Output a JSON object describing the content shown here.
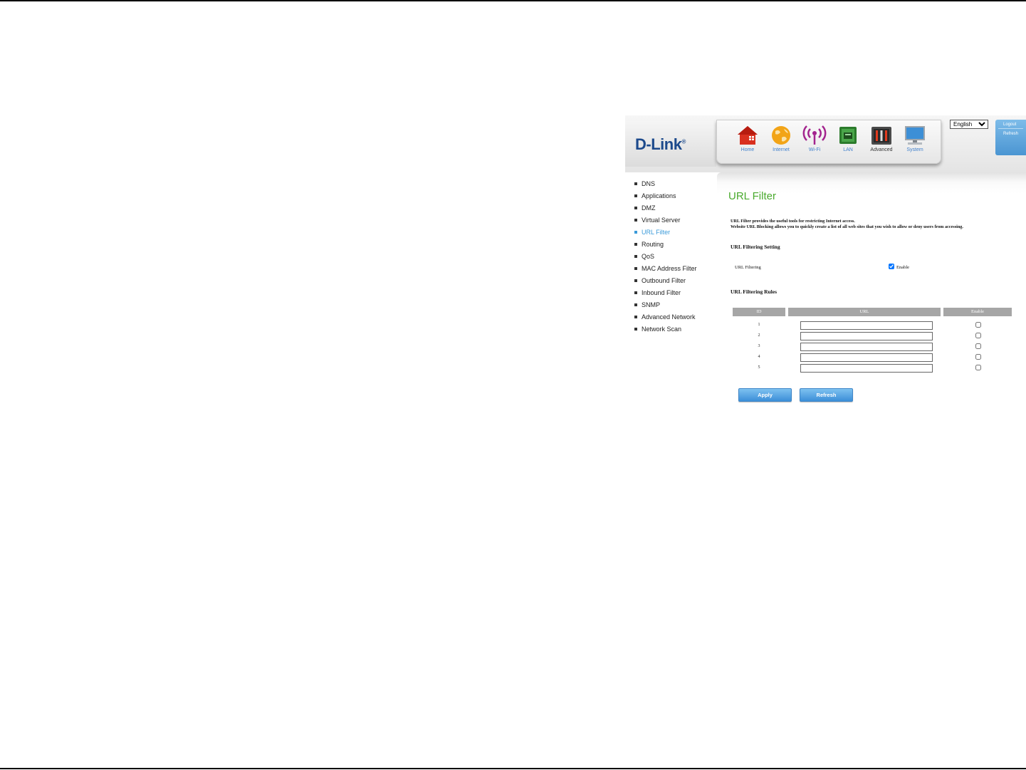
{
  "brand": {
    "logo_text": "D-Link",
    "logo_mark": "®"
  },
  "nav": [
    {
      "label": "Home",
      "icon": "home-icon"
    },
    {
      "label": "Internet",
      "icon": "globe-icon"
    },
    {
      "label": "Wi-Fi",
      "icon": "wifi-icon"
    },
    {
      "label": "LAN",
      "icon": "lan-icon"
    },
    {
      "label": "Advanced",
      "icon": "advanced-tools-icon",
      "active": true
    },
    {
      "label": "System",
      "icon": "monitor-icon"
    }
  ],
  "language": {
    "selected": "English"
  },
  "top_right": {
    "logout": "Logout",
    "refresh": "Refresh"
  },
  "menu": [
    {
      "label": "DNS"
    },
    {
      "label": "Applications"
    },
    {
      "label": "DMZ"
    },
    {
      "label": "Virtual Server"
    },
    {
      "label": "URL Filter",
      "active": true
    },
    {
      "label": "Routing"
    },
    {
      "label": "QoS"
    },
    {
      "label": "MAC Address Filter"
    },
    {
      "label": "Outbound Filter"
    },
    {
      "label": "Inbound Filter"
    },
    {
      "label": "SNMP"
    },
    {
      "label": "Advanced Network"
    },
    {
      "label": "Network Scan"
    }
  ],
  "page": {
    "title": "URL Filter",
    "desc_line1": "URL Filter provides the useful tools for restricting Internet access.",
    "desc_line2": "Website URL Blocking allows you to quickly create a list of all web sites that you wish to allow or deny users from accessing.",
    "setting_title": "URL Filtering Setting",
    "filtering_label": "URL Filtering",
    "filtering_enable_label": "Enable",
    "filtering_enabled": true,
    "rules_title": "URL Filtering Rules",
    "table_headers": {
      "id": "ID",
      "url": "URL",
      "enable": "Enable"
    },
    "rules": [
      {
        "id": "1",
        "url": "",
        "enabled": false
      },
      {
        "id": "2",
        "url": "",
        "enabled": false
      },
      {
        "id": "3",
        "url": "",
        "enabled": false
      },
      {
        "id": "4",
        "url": "",
        "enabled": false
      },
      {
        "id": "5",
        "url": "",
        "enabled": false
      }
    ],
    "apply_label": "Apply",
    "refresh_label": "Refresh"
  },
  "colors": {
    "title_green": "#4aaa2e",
    "nav_blue": "#3f7fcb",
    "button_blue": "#3c8fd8",
    "logo_blue": "#1d4a8c"
  }
}
